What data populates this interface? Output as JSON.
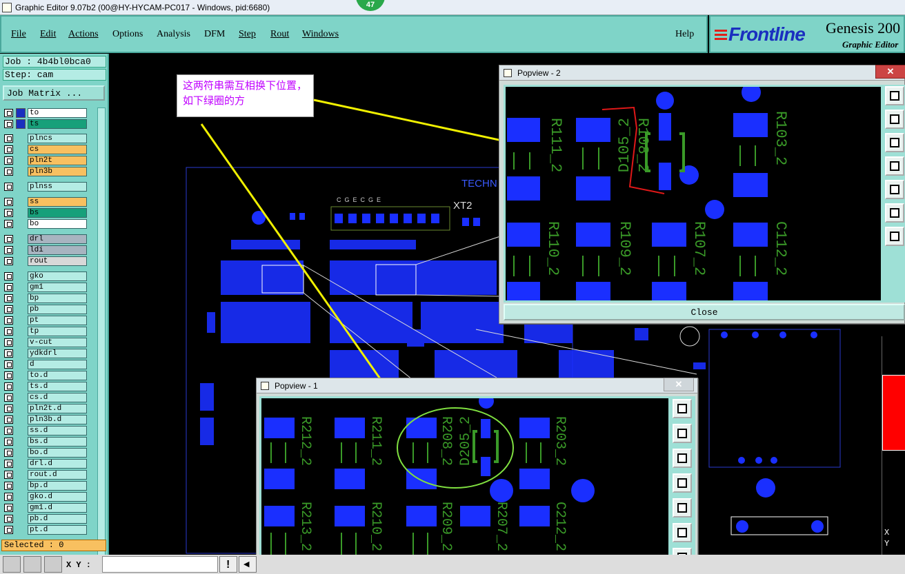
{
  "window": {
    "title": "Graphic Editor 9.07b2 (00@HY-HYCAM-PC017 - Windows, pid:6680)",
    "badge": "47"
  },
  "menu": [
    "File",
    "Edit",
    "Actions",
    "Options",
    "Analysis",
    "DFM",
    "Step",
    "Rout",
    "Windows"
  ],
  "help": "Help",
  "brand": {
    "logo": "Frontline",
    "product": "Genesis 200",
    "subtitle": "Graphic Editor"
  },
  "job": {
    "job_label": "Job : 4b4bl0bca0",
    "step_label": "Step: cam",
    "matrix_button": "Job Matrix ..."
  },
  "layers": [
    {
      "name": "to",
      "color": "#ffffff",
      "swatch": "#1a2fbf"
    },
    {
      "name": "ts",
      "color": "#17a07a",
      "swatch": "#1a2fbf"
    },
    {
      "name": "plncs",
      "color": "#b4ece4",
      "swatch": ""
    },
    {
      "name": "cs",
      "color": "#f8c060",
      "swatch": ""
    },
    {
      "name": "pln2t",
      "color": "#f8c060",
      "swatch": ""
    },
    {
      "name": "pln3b",
      "color": "#f8c060",
      "swatch": ""
    },
    {
      "name": "plnss",
      "color": "#b4ece4",
      "swatch": ""
    },
    {
      "name": "ss",
      "color": "#f8c060",
      "swatch": ""
    },
    {
      "name": "bs",
      "color": "#17a07a",
      "swatch": ""
    },
    {
      "name": "bo",
      "color": "#ffffff",
      "swatch": ""
    },
    {
      "name": "drl",
      "color": "#a8b4c0",
      "swatch": ""
    },
    {
      "name": "ldi",
      "color": "#a8b4c0",
      "swatch": ""
    },
    {
      "name": "rout",
      "color": "#d8d8d8",
      "swatch": ""
    },
    {
      "name": "gko",
      "color": "#b4ece4",
      "swatch": ""
    },
    {
      "name": "gm1",
      "color": "#b4ece4",
      "swatch": ""
    },
    {
      "name": "bp",
      "color": "#b4ece4",
      "swatch": ""
    },
    {
      "name": "pb",
      "color": "#b4ece4",
      "swatch": ""
    },
    {
      "name": "pt",
      "color": "#b4ece4",
      "swatch": ""
    },
    {
      "name": "tp",
      "color": "#b4ece4",
      "swatch": ""
    },
    {
      "name": "v-cut",
      "color": "#b4ece4",
      "swatch": ""
    },
    {
      "name": "ydkdrl",
      "color": "#b4ece4",
      "swatch": ""
    },
    {
      "name": "d",
      "color": "#b4ece4",
      "swatch": ""
    },
    {
      "name": "to.d",
      "color": "#b4ece4",
      "swatch": ""
    },
    {
      "name": "ts.d",
      "color": "#b4ece4",
      "swatch": ""
    },
    {
      "name": "cs.d",
      "color": "#b4ece4",
      "swatch": ""
    },
    {
      "name": "pln2t.d",
      "color": "#b4ece4",
      "swatch": ""
    },
    {
      "name": "pln3b.d",
      "color": "#b4ece4",
      "swatch": ""
    },
    {
      "name": "ss.d",
      "color": "#b4ece4",
      "swatch": ""
    },
    {
      "name": "bs.d",
      "color": "#b4ece4",
      "swatch": ""
    },
    {
      "name": "bo.d",
      "color": "#b4ece4",
      "swatch": ""
    },
    {
      "name": "drl.d",
      "color": "#b4ece4",
      "swatch": ""
    },
    {
      "name": "rout.d",
      "color": "#b4ece4",
      "swatch": ""
    },
    {
      "name": "bp.d",
      "color": "#b4ece4",
      "swatch": ""
    },
    {
      "name": "gko.d",
      "color": "#b4ece4",
      "swatch": ""
    },
    {
      "name": "gm1.d",
      "color": "#b4ece4",
      "swatch": ""
    },
    {
      "name": "pb.d",
      "color": "#b4ece4",
      "swatch": ""
    },
    {
      "name": "pt.d",
      "color": "#b4ece4",
      "swatch": ""
    }
  ],
  "selected": "Selected : 0",
  "xy_label": "X Y :",
  "annotation": "这两符串需互相换下位置，如下绿圈的方",
  "pcb": {
    "tech_text": "TECHN",
    "xt2": "XT2",
    "pins": "C  G  E  C  G  E"
  },
  "popview2": {
    "title": "Popview - 2",
    "close": "Close",
    "labels": [
      "R111_2",
      "D105_2",
      "R108_2",
      "R103_2",
      "R110_2",
      "R109_2",
      "R107_2",
      "C112_2"
    ]
  },
  "popview1": {
    "title": "Popview - 1",
    "labels": [
      "R212_2",
      "R211_2",
      "R208_2",
      "D205_2",
      "R203_2",
      "R213_2",
      "R210_2",
      "R209_2",
      "R207_2",
      "C212_2"
    ]
  },
  "coord_readout": {
    "x": "X",
    "y": "Y"
  }
}
